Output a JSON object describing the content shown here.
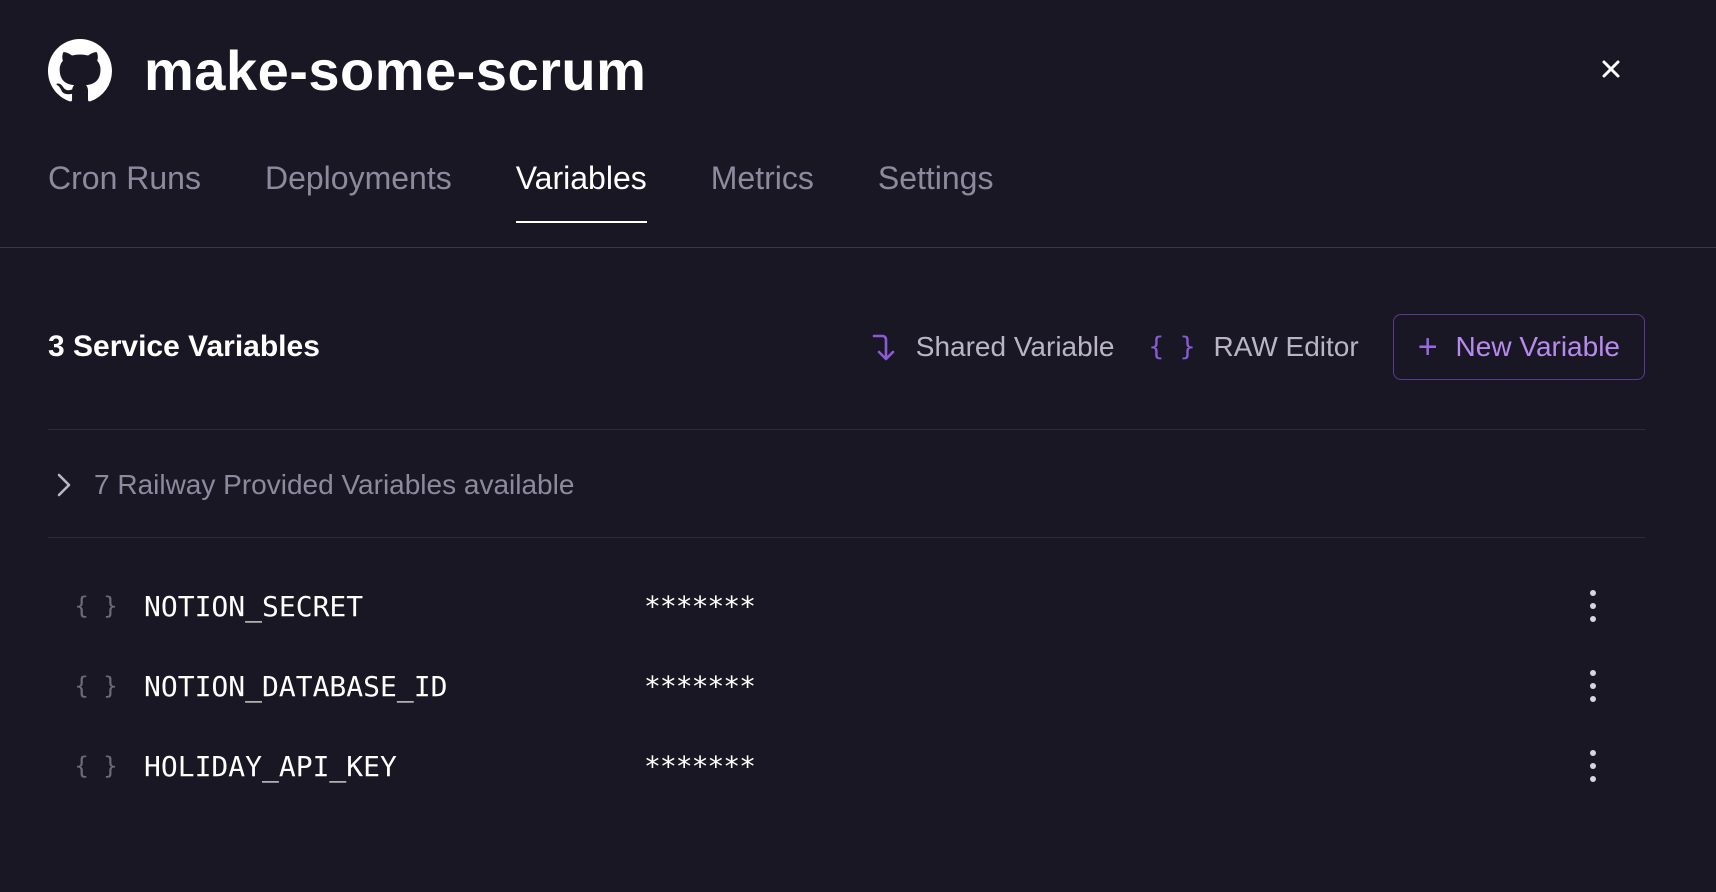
{
  "header": {
    "icon": "github-icon",
    "title": "make-some-scrum",
    "close_icon": "close-icon"
  },
  "tabs": [
    {
      "label": "Cron Runs",
      "active": false
    },
    {
      "label": "Deployments",
      "active": false
    },
    {
      "label": "Variables",
      "active": true
    },
    {
      "label": "Metrics",
      "active": false
    },
    {
      "label": "Settings",
      "active": false
    }
  ],
  "toolbar": {
    "count_label": "3 Service Variables",
    "shared_variable_label": "Shared Variable",
    "raw_editor_label": "RAW Editor",
    "new_variable_label": "New Variable"
  },
  "railway": {
    "label": "7 Railway Provided Variables available"
  },
  "variables": [
    {
      "icon": "{}",
      "name": "NOTION_SECRET",
      "value": "*******"
    },
    {
      "icon": "{}",
      "name": "NOTION_DATABASE_ID",
      "value": "*******"
    },
    {
      "icon": "{}",
      "name": "HOLIDAY_API_KEY",
      "value": "*******"
    }
  ],
  "colors": {
    "background": "#1a1724",
    "accent": "#8a5bd6",
    "accent_text": "#b78af0"
  }
}
